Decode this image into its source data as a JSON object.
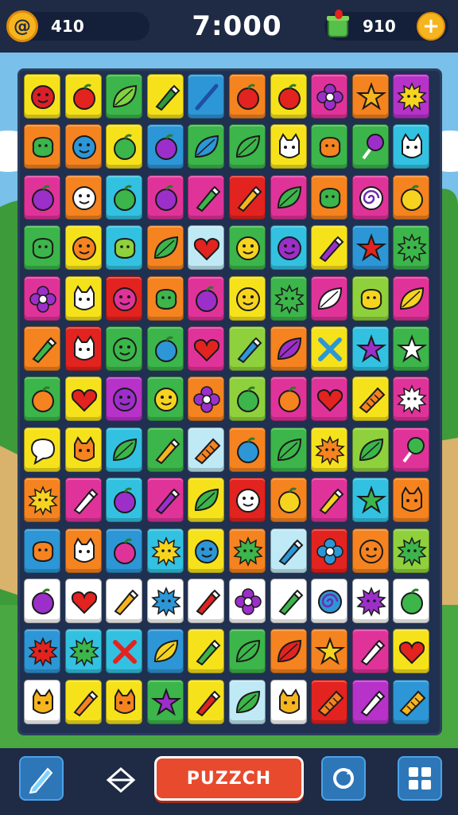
{
  "header": {
    "score_label": "410",
    "score_value": "410",
    "score_prefix": "+",
    "timer": "7:000",
    "gems_value": "910",
    "plus_label": "+"
  },
  "footer": {
    "puzzle_label": "PUZZCH"
  },
  "colors": {
    "yellow": "#f6e21b",
    "orange": "#f5831f",
    "red": "#e2231f",
    "magenta": "#e0339a",
    "purple": "#b632c9",
    "green": "#3cb54a",
    "lime": "#8fd13c",
    "blue": "#2d96d6",
    "cyan": "#33c1e1",
    "pale": "#bfe9f5",
    "white": "#ffffff"
  },
  "board": {
    "rows": [
      [
        [
          "yellow",
          "face-icon",
          "#d9202a"
        ],
        [
          "yellow",
          "fruit-icon",
          "#e2231f"
        ],
        [
          "green",
          "leaf-icon",
          "#7fd340"
        ],
        [
          "yellow",
          "pencil-icon",
          "#2e9a3a"
        ],
        [
          "blue",
          "stick-icon",
          "#1f4fa0"
        ],
        [
          "orange",
          "fruit-icon",
          "#e2231f"
        ],
        [
          "yellow",
          "fruit-icon",
          "#e2231f"
        ],
        [
          "magenta",
          "flower-icon",
          "#9c2fc9"
        ],
        [
          "orange",
          "star-icon",
          "#f6b51e"
        ],
        [
          "purple",
          "sun-icon",
          "#f6d31e"
        ]
      ],
      [
        [
          "orange",
          "blob-icon",
          "#3cb54a"
        ],
        [
          "orange",
          "face-icon",
          "#2d96d6"
        ],
        [
          "yellow",
          "fruit-icon",
          "#3cb54a"
        ],
        [
          "blue",
          "fruit-icon",
          "#9c2fc9"
        ],
        [
          "green",
          "leaf-icon",
          "#2d96d6"
        ],
        [
          "green",
          "leaf-icon",
          "#3cb54a"
        ],
        [
          "yellow",
          "cat-icon",
          "#ffffff"
        ],
        [
          "green",
          "blob-icon",
          "#f5831f"
        ],
        [
          "green",
          "lolly-icon",
          "#9c2fc9"
        ],
        [
          "cyan",
          "cat-icon",
          "#ffffff"
        ]
      ],
      [
        [
          "magenta",
          "fruit-icon",
          "#9c2fc9"
        ],
        [
          "orange",
          "face-icon",
          "#ffffff"
        ],
        [
          "cyan",
          "fruit-icon",
          "#3cb54a"
        ],
        [
          "magenta",
          "fruit-icon",
          "#9c2fc9"
        ],
        [
          "magenta",
          "pencil-icon",
          "#3cb54a"
        ],
        [
          "red",
          "pencil-icon",
          "#f6b51e"
        ],
        [
          "magenta",
          "leaf-icon",
          "#3cb54a"
        ],
        [
          "orange",
          "blob-icon",
          "#3cb54a"
        ],
        [
          "magenta",
          "swirl-icon",
          "#ffffff"
        ],
        [
          "orange",
          "fruit-icon",
          "#f6d31e"
        ]
      ],
      [
        [
          "green",
          "blob-icon",
          "#3cb54a"
        ],
        [
          "yellow",
          "face-icon",
          "#f5831f"
        ],
        [
          "cyan",
          "blob-icon",
          "#8fd13c"
        ],
        [
          "orange",
          "leaf-icon",
          "#3cb54a"
        ],
        [
          "pale",
          "heart-icon",
          "#e2231f"
        ],
        [
          "green",
          "face-icon",
          "#f6d31e"
        ],
        [
          "cyan",
          "face-icon",
          "#9c2fc9"
        ],
        [
          "yellow",
          "pencil-icon",
          "#9c2fc9"
        ],
        [
          "blue",
          "star-icon",
          "#e2231f"
        ],
        [
          "green",
          "sun-icon",
          "#3cb54a"
        ]
      ],
      [
        [
          "magenta",
          "flower-icon",
          "#9c2fc9"
        ],
        [
          "yellow",
          "cat-icon",
          "#ffffff"
        ],
        [
          "red",
          "face-icon",
          "#e0339a"
        ],
        [
          "orange",
          "blob-icon",
          "#3cb54a"
        ],
        [
          "magenta",
          "fruit-icon",
          "#9c2fc9"
        ],
        [
          "yellow",
          "face-icon",
          "#f6d31e"
        ],
        [
          "green",
          "sun-icon",
          "#3cb54a"
        ],
        [
          "magenta",
          "leaf-icon",
          "#ffffff"
        ],
        [
          "lime",
          "blob-icon",
          "#f6d31e"
        ],
        [
          "magenta",
          "leaf-icon",
          "#f6d31e"
        ]
      ],
      [
        [
          "orange",
          "pencil-icon",
          "#3cb54a"
        ],
        [
          "red",
          "cat-icon",
          "#ffffff"
        ],
        [
          "green",
          "face-icon",
          "#3cb54a"
        ],
        [
          "green",
          "fruit-icon",
          "#2d96d6"
        ],
        [
          "magenta",
          "heart-icon",
          "#e2231f"
        ],
        [
          "lime",
          "pencil-icon",
          "#2d96d6"
        ],
        [
          "orange",
          "leaf-icon",
          "#9c2fc9"
        ],
        [
          "yellow",
          "cross-icon",
          "#2d96d6"
        ],
        [
          "cyan",
          "star-icon",
          "#9c2fc9"
        ],
        [
          "green",
          "star-icon",
          "#ffffff"
        ]
      ],
      [
        [
          "green",
          "fruit-icon",
          "#f5831f"
        ],
        [
          "yellow",
          "heart-icon",
          "#e2231f"
        ],
        [
          "purple",
          "face-icon",
          "#9c2fc9"
        ],
        [
          "green",
          "face-icon",
          "#f6d31e"
        ],
        [
          "orange",
          "flower-icon",
          "#9c2fc9"
        ],
        [
          "lime",
          "fruit-icon",
          "#3cb54a"
        ],
        [
          "magenta",
          "fruit-icon",
          "#f5831f"
        ],
        [
          "magenta",
          "heart-icon",
          "#e2231f"
        ],
        [
          "yellow",
          "grill-icon",
          "#f5831f"
        ],
        [
          "magenta",
          "sun-icon",
          "#ffffff"
        ]
      ],
      [
        [
          "yellow",
          "bubble-icon",
          "#ffffff"
        ],
        [
          "yellow",
          "cat-icon",
          "#f5831f"
        ],
        [
          "cyan",
          "leaf-icon",
          "#3cb54a"
        ],
        [
          "green",
          "pencil-icon",
          "#f6b51e"
        ],
        [
          "pale",
          "grill-icon",
          "#f5831f"
        ],
        [
          "orange",
          "fruit-icon",
          "#2d96d6"
        ],
        [
          "green",
          "leaf-icon",
          "#3cb54a"
        ],
        [
          "yellow",
          "sun-icon",
          "#f5831f"
        ],
        [
          "lime",
          "leaf-icon",
          "#3cb54a"
        ],
        [
          "magenta",
          "lolly-icon",
          "#3cb54a"
        ]
      ],
      [
        [
          "orange",
          "sun-icon",
          "#f6d31e"
        ],
        [
          "magenta",
          "pencil-icon",
          "#ffffff"
        ],
        [
          "cyan",
          "fruit-icon",
          "#9c2fc9"
        ],
        [
          "magenta",
          "pencil-icon",
          "#9c2fc9"
        ],
        [
          "yellow",
          "leaf-icon",
          "#3cb54a"
        ],
        [
          "red",
          "face-icon",
          "#ffffff"
        ],
        [
          "orange",
          "fruit-icon",
          "#f6d31e"
        ],
        [
          "magenta",
          "pencil-icon",
          "#f6d31e"
        ],
        [
          "cyan",
          "star-icon",
          "#3cb54a"
        ],
        [
          "orange",
          "cat-icon",
          "#f5831f"
        ]
      ],
      [
        [
          "blue",
          "blob-icon",
          "#f5831f"
        ],
        [
          "orange",
          "cat-icon",
          "#ffffff"
        ],
        [
          "blue",
          "fruit-icon",
          "#e0339a"
        ],
        [
          "cyan",
          "sun-icon",
          "#f6d31e"
        ],
        [
          "yellow",
          "face-icon",
          "#2d96d6"
        ],
        [
          "orange",
          "sun-icon",
          "#3cb54a"
        ],
        [
          "pale",
          "pencil-icon",
          "#2d96d6"
        ],
        [
          "red",
          "flower-icon",
          "#2d96d6"
        ],
        [
          "orange",
          "face-icon",
          "#f5831f"
        ],
        [
          "lime",
          "sun-icon",
          "#3cb54a"
        ]
      ],
      [
        [
          "white",
          "fruit-icon",
          "#9c2fc9"
        ],
        [
          "white",
          "heart-icon",
          "#e2231f"
        ],
        [
          "white",
          "pencil-icon",
          "#f6b51e"
        ],
        [
          "white",
          "sun-icon",
          "#2d96d6"
        ],
        [
          "white",
          "pencil-icon",
          "#e2231f"
        ],
        [
          "white",
          "flower-icon",
          "#9c2fc9"
        ],
        [
          "white",
          "pencil-icon",
          "#3cb54a"
        ],
        [
          "white",
          "swirl-icon",
          "#2d96d6"
        ],
        [
          "white",
          "sun-icon",
          "#9c2fc9"
        ],
        [
          "white",
          "fruit-icon",
          "#3cb54a"
        ]
      ],
      [
        [
          "blue",
          "sun-icon",
          "#e2231f"
        ],
        [
          "cyan",
          "sun-icon",
          "#3cb54a"
        ],
        [
          "cyan",
          "cross-icon",
          "#e2231f"
        ],
        [
          "blue",
          "leaf-icon",
          "#f6d31e"
        ],
        [
          "yellow",
          "pencil-icon",
          "#3cb54a"
        ],
        [
          "green",
          "leaf-icon",
          "#3cb54a"
        ],
        [
          "orange",
          "leaf-icon",
          "#e2231f"
        ],
        [
          "orange",
          "star-icon",
          "#f6d31e"
        ],
        [
          "magenta",
          "pencil-icon",
          "#ffffff"
        ],
        [
          "yellow",
          "heart-icon",
          "#e2231f"
        ]
      ],
      [
        [
          "white",
          "cat-icon",
          "#f6b51e"
        ],
        [
          "yellow",
          "pencil-icon",
          "#f5831f"
        ],
        [
          "yellow",
          "cat-icon",
          "#f5831f"
        ],
        [
          "green",
          "star-icon",
          "#9c2fc9"
        ],
        [
          "yellow",
          "pencil-icon",
          "#e2231f"
        ],
        [
          "pale",
          "leaf-icon",
          "#3cb54a"
        ],
        [
          "white",
          "cat-icon",
          "#f6b51e"
        ],
        [
          "red",
          "grill-icon",
          "#f5831f"
        ],
        [
          "purple",
          "pencil-icon",
          "#ffffff"
        ],
        [
          "blue",
          "grill-icon",
          "#f6b51e"
        ]
      ]
    ]
  }
}
